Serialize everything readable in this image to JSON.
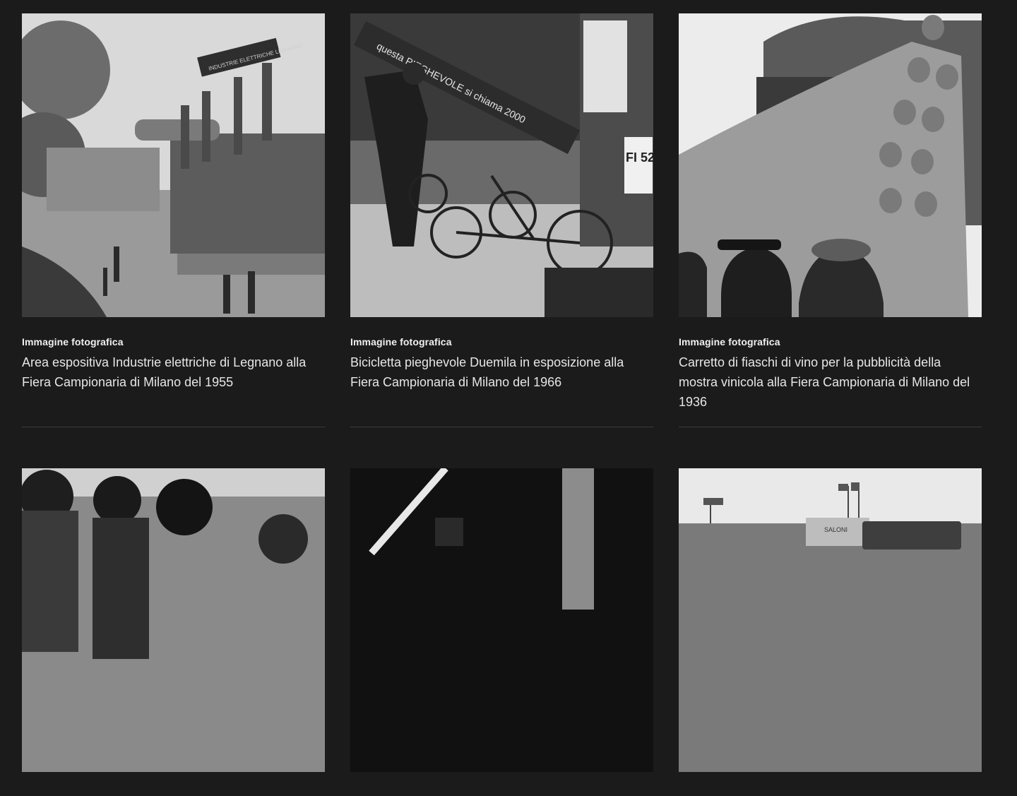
{
  "cards": [
    {
      "category": "Immagine fotografica",
      "title": "Area espositiva Industrie elettriche di Legnano alla Fiera Campionaria di Milano del 1955",
      "sign_text": "INDUSTRIE ELETTRICHE LEGNANO"
    },
    {
      "category": "Immagine fotografica",
      "title": "Bicicletta pieghevole Duemila in esposizione alla Fiera Campionaria di Milano del 1966",
      "banner_text": "questa PIEGHEVOLE si chiama 2000",
      "plate_text": "FI 52"
    },
    {
      "category": "Immagine fotografica",
      "title": "Carretto di fiaschi di vino per la pubblicità della mostra vinicola alla Fiera Campionaria di Milano del 1936"
    },
    {
      "category": "",
      "title": ""
    },
    {
      "category": "",
      "title": ""
    },
    {
      "category": "",
      "title": "",
      "sign_text": "SALONI"
    }
  ]
}
